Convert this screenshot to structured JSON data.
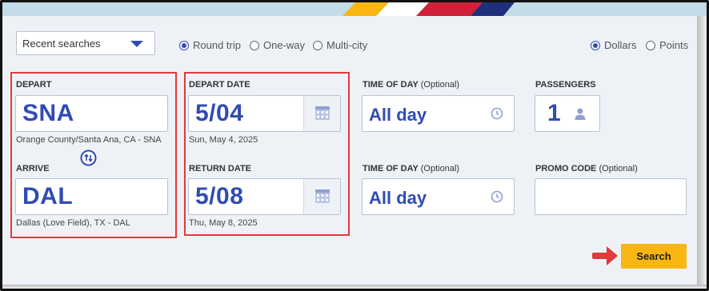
{
  "recent_searches": {
    "label": "Recent searches"
  },
  "trip_type": {
    "options": [
      "Round trip",
      "One-way",
      "Multi-city"
    ],
    "selected": "Round trip"
  },
  "currency": {
    "options": [
      "Dollars",
      "Points"
    ],
    "selected": "Dollars"
  },
  "depart": {
    "label": "DEPART",
    "code": "SNA",
    "description": "Orange County/Santa Ana, CA - SNA"
  },
  "arrive": {
    "label": "ARRIVE",
    "code": "DAL",
    "description": "Dallas (Love Field), TX - DAL"
  },
  "depart_date": {
    "label": "DEPART DATE",
    "value": "5/04",
    "full": "Sun, May 4, 2025"
  },
  "return_date": {
    "label": "RETURN DATE",
    "value": "5/08",
    "full": "Thu, May 8, 2025"
  },
  "time_of_day_depart": {
    "label": "TIME OF DAY",
    "optional": "(Optional)",
    "value": "All day"
  },
  "time_of_day_return": {
    "label": "TIME OF DAY",
    "optional": "(Optional)",
    "value": "All day"
  },
  "passengers": {
    "label": "PASSENGERS",
    "value": "1"
  },
  "promo": {
    "label": "PROMO CODE",
    "optional": "(Optional)",
    "value": ""
  },
  "search_button": {
    "label": "Search"
  },
  "colors": {
    "brand_blue": "#304cb2",
    "search_yellow": "#f9b612",
    "highlight_red": "#e03a3a",
    "panel_bg": "#eef2f7"
  }
}
